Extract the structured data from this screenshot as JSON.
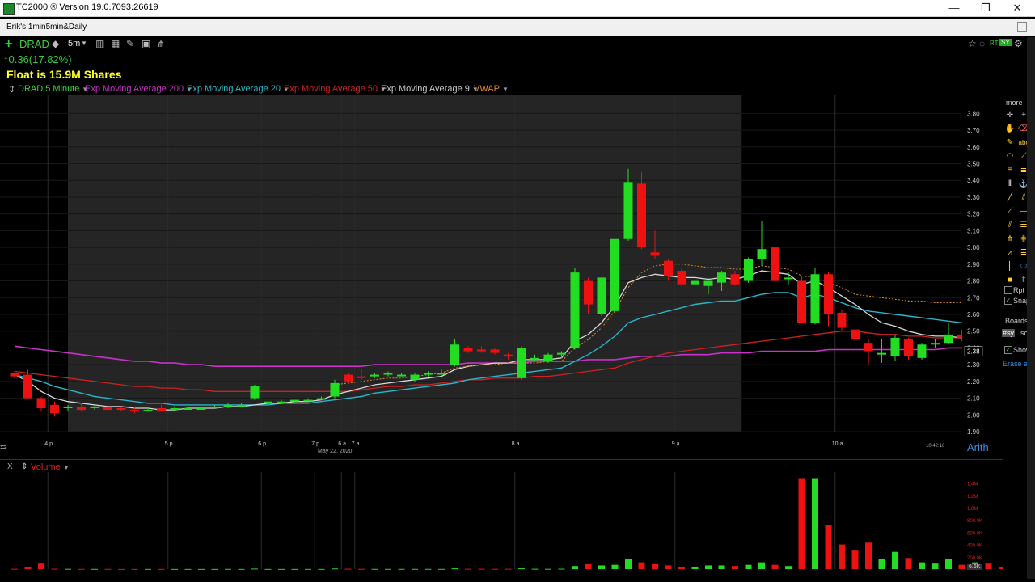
{
  "window": {
    "title": "TC2000 ® Version 19.0.7093.26619",
    "minimize": "—",
    "maximize": "❐",
    "close": "✕"
  },
  "layout": {
    "name": "Erik's 1min5min&Daily"
  },
  "symbol_bar": {
    "symbol": "DRAD",
    "interval": "5m",
    "change_text": "↑0.36(17.82%)",
    "note": "Float is 15.9M Shares",
    "right_icons": [
      "RT",
      "SY"
    ]
  },
  "legend": {
    "price": "DRAD 5 Minute",
    "ema200": "Exp Moving Average 200",
    "ema20": "Exp Moving Average 20",
    "ema50": "Exp Moving Average 50",
    "ema9": "Exp Moving Average 9",
    "vwap": "VWAP"
  },
  "colors": {
    "up": "#22dd22",
    "down": "#ee1111",
    "ema200": "#c832c8",
    "ema20": "#2ab5c8",
    "ema50": "#cc2222",
    "ema9": "#d8d8d8",
    "vwap": "#e08a1e",
    "legend_price": "#3cd23c",
    "legend_ema200": "#c832c8",
    "legend_ema20": "#2ab5c8",
    "legend_ema50": "#cc2222",
    "legend_ema9": "#c8c8c8",
    "legend_vwap": "#e08a1e"
  },
  "right_panel": {
    "more": "more",
    "rpt": "Rpt",
    "snap": "Snap",
    "boards": "Boards",
    "board_tag": "#sy",
    "scr": "scr",
    "show": "Show",
    "erase": "Erase all",
    "scale_mode": "Arith"
  },
  "volume_panel": {
    "title": "Volume",
    "close": "X",
    "cur_vol": "6.6K"
  },
  "chart_data": {
    "type": "candlestick",
    "symbol": "DRAD",
    "interval": "5 Minute",
    "date_label": "May 22, 2020",
    "current_price_label": "2.38",
    "ylim": [
      1.9,
      3.85
    ],
    "y_ticks": [
      "3.80",
      "3.70",
      "3.60",
      "3.50",
      "3.40",
      "3.30",
      "3.20",
      "3.10",
      "3.00",
      "2.90",
      "2.80",
      "2.70",
      "2.60",
      "2.50",
      "2.40",
      "2.30",
      "2.20",
      "2.10",
      "2.00",
      "1.90"
    ],
    "x_ticks": [
      {
        "label": "4 p",
        "i": 2.5
      },
      {
        "label": "5 p",
        "i": 11.5
      },
      {
        "label": "6 p",
        "i": 18.5
      },
      {
        "label": "7 p",
        "i": 22.5
      },
      {
        "label": "6 a",
        "i": 24.5
      },
      {
        "label": "7 a",
        "i": 25.5
      },
      {
        "label": "8 a",
        "i": 37.5
      },
      {
        "label": "9 a",
        "i": 49.5
      },
      {
        "label": "10 a",
        "i": 61.5
      }
    ],
    "time_label": "10:42:16",
    "premarket_shade": [
      4,
      54.5
    ],
    "candles": [
      [
        2.25,
        2.26,
        2.22,
        2.23
      ],
      [
        2.24,
        2.27,
        2.16,
        2.1
      ],
      [
        2.1,
        2.11,
        2.02,
        2.04
      ],
      [
        2.06,
        2.08,
        1.99,
        2.01
      ],
      [
        2.04,
        2.06,
        2.02,
        2.05
      ],
      [
        2.05,
        2.07,
        2.02,
        2.03
      ],
      [
        2.04,
        2.06,
        2.03,
        2.05
      ],
      [
        2.05,
        2.06,
        2.02,
        2.03
      ],
      [
        2.04,
        2.05,
        2.02,
        2.03
      ],
      [
        2.03,
        2.05,
        2.01,
        2.02
      ],
      [
        2.03,
        2.04,
        2.02,
        2.03
      ],
      [
        2.04,
        2.06,
        2.02,
        2.02
      ],
      [
        2.03,
        2.05,
        2.02,
        2.04
      ],
      [
        2.04,
        2.05,
        2.03,
        2.04
      ],
      [
        2.04,
        2.05,
        2.03,
        2.04
      ],
      [
        2.05,
        2.06,
        2.04,
        2.05
      ],
      [
        2.05,
        2.07,
        2.04,
        2.06
      ],
      [
        2.06,
        2.07,
        2.05,
        2.06
      ],
      [
        2.1,
        2.18,
        2.09,
        2.17
      ],
      [
        2.08,
        2.09,
        2.07,
        2.08
      ],
      [
        2.08,
        2.09,
        2.07,
        2.08
      ],
      [
        2.08,
        2.09,
        2.07,
        2.09
      ],
      [
        2.09,
        2.1,
        2.08,
        2.09
      ],
      [
        2.1,
        2.11,
        2.09,
        2.1
      ],
      [
        2.11,
        2.21,
        2.1,
        2.19
      ],
      [
        2.24,
        2.25,
        2.19,
        2.2
      ],
      [
        2.23,
        2.27,
        2.21,
        2.22
      ],
      [
        2.23,
        2.25,
        2.22,
        2.24
      ],
      [
        2.24,
        2.26,
        2.23,
        2.25
      ],
      [
        2.24,
        2.25,
        2.23,
        2.24
      ],
      [
        2.21,
        2.25,
        2.2,
        2.24
      ],
      [
        2.24,
        2.26,
        2.23,
        2.25
      ],
      [
        2.25,
        2.27,
        2.24,
        2.25
      ],
      [
        2.3,
        2.45,
        2.29,
        2.42
      ],
      [
        2.4,
        2.41,
        2.37,
        2.38
      ],
      [
        2.39,
        2.41,
        2.37,
        2.38
      ],
      [
        2.39,
        2.4,
        2.36,
        2.37
      ],
      [
        2.36,
        2.37,
        2.33,
        2.35
      ],
      [
        2.22,
        2.41,
        2.21,
        2.4
      ],
      [
        2.34,
        2.36,
        2.32,
        2.34
      ],
      [
        2.32,
        2.37,
        2.31,
        2.36
      ],
      [
        2.36,
        2.38,
        2.34,
        2.37
      ],
      [
        2.4,
        2.88,
        2.39,
        2.85
      ],
      [
        2.8,
        2.82,
        2.6,
        2.66
      ],
      [
        2.6,
        2.82,
        2.59,
        2.82
      ],
      [
        2.62,
        3.06,
        2.59,
        3.05
      ],
      [
        3.05,
        3.47,
        3.04,
        3.39
      ],
      [
        3.38,
        3.45,
        2.99,
        3.0
      ],
      [
        2.97,
        3.1,
        2.93,
        2.95
      ],
      [
        2.92,
        2.93,
        2.8,
        2.83
      ],
      [
        2.86,
        2.88,
        2.77,
        2.78
      ],
      [
        2.78,
        2.82,
        2.75,
        2.8
      ],
      [
        2.77,
        2.8,
        2.72,
        2.8
      ],
      [
        2.79,
        2.86,
        2.74,
        2.85
      ],
      [
        2.84,
        2.86,
        2.77,
        2.78
      ],
      [
        2.8,
        2.94,
        2.79,
        2.93
      ],
      [
        2.93,
        3.16,
        2.89,
        2.99
      ],
      [
        3.0,
        3.0,
        2.78,
        2.8
      ],
      [
        2.81,
        2.85,
        2.78,
        2.82
      ],
      [
        2.8,
        2.83,
        2.55,
        2.55
      ],
      [
        2.55,
        2.88,
        2.54,
        2.84
      ],
      [
        2.84,
        2.85,
        2.53,
        2.6
      ],
      [
        2.61,
        2.63,
        2.5,
        2.52
      ],
      [
        2.51,
        2.56,
        2.43,
        2.45
      ],
      [
        2.43,
        2.45,
        2.3,
        2.38
      ],
      [
        2.36,
        2.45,
        2.31,
        2.37
      ],
      [
        2.35,
        2.48,
        2.32,
        2.46
      ],
      [
        2.45,
        2.46,
        2.33,
        2.35
      ],
      [
        2.34,
        2.43,
        2.33,
        2.42
      ],
      [
        2.42,
        2.45,
        2.4,
        2.43
      ],
      [
        2.43,
        2.55,
        2.42,
        2.48
      ],
      [
        2.48,
        2.51,
        2.44,
        2.46
      ],
      [
        2.45,
        2.52,
        2.44,
        2.5
      ],
      [
        2.48,
        2.5,
        2.42,
        2.45
      ],
      [
        2.43,
        2.47,
        2.38,
        2.4
      ],
      [
        2.39,
        2.41,
        2.37,
        2.38
      ]
    ],
    "ema200": [
      2.41,
      2.4,
      2.39,
      2.38,
      2.37,
      2.36,
      2.35,
      2.34,
      2.33,
      2.32,
      2.32,
      2.31,
      2.31,
      2.3,
      2.3,
      2.29,
      2.29,
      2.29,
      2.29,
      2.29,
      2.29,
      2.29,
      2.29,
      2.29,
      2.29,
      2.29,
      2.29,
      2.3,
      2.3,
      2.3,
      2.3,
      2.3,
      2.3,
      2.3,
      2.31,
      2.31,
      2.31,
      2.31,
      2.31,
      2.32,
      2.32,
      2.32,
      2.32,
      2.33,
      2.33,
      2.33,
      2.34,
      2.35,
      2.35,
      2.35,
      2.36,
      2.36,
      2.36,
      2.37,
      2.37,
      2.37,
      2.38,
      2.38,
      2.38,
      2.38,
      2.38,
      2.39,
      2.39,
      2.39,
      2.39,
      2.39,
      2.39,
      2.39,
      2.39,
      2.39,
      2.4,
      2.4,
      2.4,
      2.4,
      2.4,
      2.4
    ],
    "ema50": [
      2.26,
      2.25,
      2.24,
      2.23,
      2.22,
      2.21,
      2.2,
      2.19,
      2.18,
      2.17,
      2.17,
      2.16,
      2.16,
      2.15,
      2.15,
      2.14,
      2.14,
      2.14,
      2.14,
      2.14,
      2.14,
      2.14,
      2.14,
      2.14,
      2.14,
      2.14,
      2.15,
      2.16,
      2.17,
      2.17,
      2.18,
      2.18,
      2.19,
      2.2,
      2.21,
      2.21,
      2.22,
      2.22,
      2.22,
      2.23,
      2.23,
      2.24,
      2.25,
      2.26,
      2.27,
      2.28,
      2.31,
      2.33,
      2.35,
      2.37,
      2.38,
      2.39,
      2.4,
      2.41,
      2.42,
      2.43,
      2.44,
      2.45,
      2.46,
      2.47,
      2.48,
      2.49,
      2.5,
      2.5,
      2.49,
      2.48,
      2.48,
      2.47,
      2.47,
      2.46,
      2.46,
      2.46,
      2.46,
      2.46,
      2.45,
      2.45
    ],
    "ema20": [
      2.24,
      2.22,
      2.2,
      2.17,
      2.15,
      2.13,
      2.11,
      2.1,
      2.09,
      2.08,
      2.07,
      2.07,
      2.06,
      2.06,
      2.06,
      2.06,
      2.06,
      2.06,
      2.06,
      2.06,
      2.07,
      2.07,
      2.07,
      2.08,
      2.09,
      2.1,
      2.11,
      2.13,
      2.14,
      2.15,
      2.16,
      2.17,
      2.18,
      2.19,
      2.21,
      2.22,
      2.23,
      2.24,
      2.25,
      2.26,
      2.27,
      2.28,
      2.32,
      2.36,
      2.41,
      2.47,
      2.55,
      2.58,
      2.6,
      2.62,
      2.64,
      2.66,
      2.67,
      2.68,
      2.68,
      2.7,
      2.72,
      2.73,
      2.73,
      2.7,
      2.72,
      2.7,
      2.67,
      2.64,
      2.62,
      2.61,
      2.6,
      2.59,
      2.58,
      2.57,
      2.56,
      2.55,
      2.54,
      2.54,
      2.53,
      2.52
    ],
    "ema9": [
      2.24,
      2.2,
      2.14,
      2.1,
      2.08,
      2.07,
      2.06,
      2.05,
      2.05,
      2.04,
      2.04,
      2.03,
      2.03,
      2.04,
      2.04,
      2.04,
      2.05,
      2.05,
      2.06,
      2.07,
      2.07,
      2.08,
      2.08,
      2.09,
      2.12,
      2.14,
      2.16,
      2.18,
      2.19,
      2.2,
      2.21,
      2.22,
      2.23,
      2.27,
      2.29,
      2.3,
      2.31,
      2.31,
      2.33,
      2.33,
      2.33,
      2.34,
      2.44,
      2.48,
      2.55,
      2.65,
      2.79,
      2.82,
      2.84,
      2.83,
      2.82,
      2.82,
      2.81,
      2.82,
      2.81,
      2.83,
      2.86,
      2.85,
      2.84,
      2.78,
      2.8,
      2.76,
      2.71,
      2.66,
      2.6,
      2.55,
      2.53,
      2.5,
      2.48,
      2.47,
      2.47,
      2.46,
      2.47,
      2.46,
      2.45,
      2.43
    ],
    "vwap": [
      null,
      null,
      null,
      null,
      null,
      null,
      null,
      null,
      null,
      null,
      null,
      null,
      null,
      null,
      null,
      null,
      null,
      null,
      null,
      null,
      null,
      null,
      null,
      null,
      2.18,
      2.19,
      2.2,
      2.21,
      2.22,
      2.22,
      2.23,
      2.24,
      2.25,
      2.28,
      2.29,
      2.3,
      2.3,
      2.31,
      2.31,
      2.31,
      2.32,
      2.32,
      2.4,
      2.45,
      2.52,
      2.62,
      2.76,
      2.85,
      2.89,
      2.9,
      2.9,
      2.89,
      2.88,
      2.88,
      2.87,
      2.87,
      2.89,
      2.88,
      2.87,
      2.83,
      2.82,
      2.79,
      2.76,
      2.72,
      2.71,
      2.7,
      2.69,
      2.68,
      2.68,
      2.67,
      2.67,
      2.67,
      2.66,
      2.66,
      2.66,
      2.66
    ],
    "volume": {
      "ylim": [
        0,
        1500000
      ],
      "y_ticks": [
        "1.4M",
        "1.2M",
        "1.0M",
        "800.0K",
        "600.0K",
        "400.0K",
        "200.0K"
      ],
      "values": [
        5000,
        40000,
        90000,
        6000,
        4000,
        3000,
        3000,
        3000,
        2000,
        2000,
        2000,
        3000,
        2000,
        2000,
        2000,
        2000,
        3000,
        2000,
        8000,
        2000,
        2000,
        2000,
        2000,
        2000,
        10000,
        6000,
        4000,
        3000,
        3000,
        3000,
        3000,
        3000,
        3000,
        12000,
        5000,
        5000,
        4000,
        5000,
        12000,
        5000,
        4000,
        6000,
        50000,
        80000,
        60000,
        70000,
        170000,
        110000,
        80000,
        60000,
        40000,
        40000,
        60000,
        60000,
        50000,
        70000,
        110000,
        70000,
        50000,
        1480000,
        1480000,
        720000,
        400000,
        300000,
        430000,
        160000,
        280000,
        180000,
        110000,
        90000,
        170000,
        70000,
        110000,
        90000,
        40000,
        6600
      ]
    }
  }
}
